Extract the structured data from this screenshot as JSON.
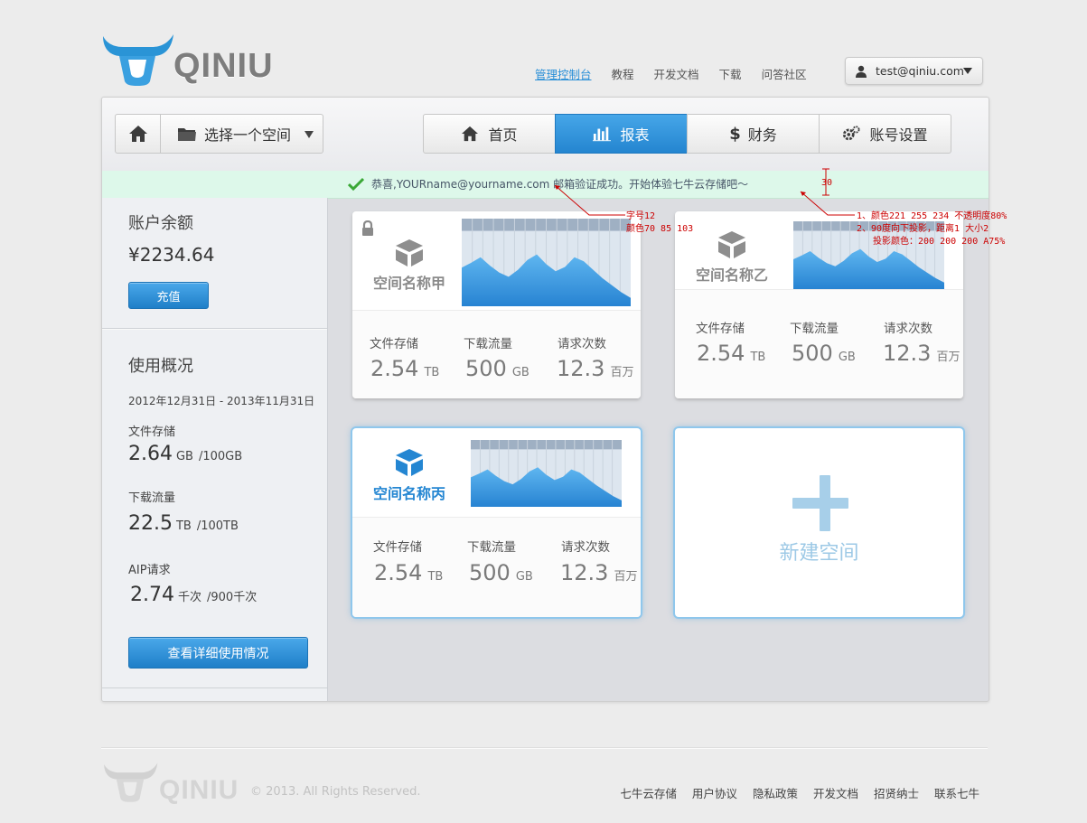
{
  "brand": {
    "logo_text": "QINIU"
  },
  "topnav": {
    "items": [
      "管理控制台",
      "教程",
      "开发文档",
      "下载",
      "问答社区"
    ],
    "user_email": "test@qiniu.com"
  },
  "toolbar": {
    "space_select_label": "选择一个空间",
    "tabs": [
      {
        "label": "首页",
        "icon": "home-icon"
      },
      {
        "label": "报表",
        "icon": "bar-chart-icon"
      },
      {
        "label": "财务",
        "icon": "dollar-icon",
        "glyph": "$"
      },
      {
        "label": "账号设置",
        "icon": "gear-icon"
      }
    ],
    "active_tab": "报表"
  },
  "notice": {
    "message": "恭喜,YOURname@yourname.com 邮箱验证成功。开始体验七牛云存储吧～"
  },
  "sidebar": {
    "balance_title": "账户余额",
    "balance": "¥2234.64",
    "recharge_label": "充值",
    "usage_title": "使用概况",
    "date_range": "2012年12月31日 - 2013年11月31日",
    "storage": {
      "label": "文件存储",
      "value": "2.64",
      "unit": "GB",
      "quota": "/100GB"
    },
    "traffic": {
      "label": "下载流量",
      "value": "22.5",
      "unit": "TB",
      "quota": "/100TB"
    },
    "api": {
      "label": "AIP请求",
      "value": "2.74",
      "unit": "千次",
      "quota": "/900千次"
    },
    "detail_button": "查看详细使用情况"
  },
  "cards": [
    {
      "name": "空间名称甲",
      "locked": true,
      "selected": false,
      "labels": [
        "文件存储",
        "下载流量",
        "请求次数"
      ],
      "storage": {
        "value": "2.54",
        "unit": "TB"
      },
      "traffic": {
        "value": "500",
        "unit": "GB"
      },
      "requests": {
        "value": "12.3",
        "unit": "百万"
      }
    },
    {
      "name": "空间名称乙",
      "locked": false,
      "selected": false,
      "labels": [
        "文件存储",
        "下载流量",
        "请求次数"
      ],
      "storage": {
        "value": "2.54",
        "unit": "TB"
      },
      "traffic": {
        "value": "500",
        "unit": "GB"
      },
      "requests": {
        "value": "12.3",
        "unit": "百万"
      }
    },
    {
      "name": "空间名称丙",
      "locked": false,
      "selected": true,
      "labels": [
        "文件存储",
        "下载流量",
        "请求次数"
      ],
      "storage": {
        "value": "2.54",
        "unit": "TB"
      },
      "traffic": {
        "value": "500",
        "unit": "GB"
      },
      "requests": {
        "value": "12.3",
        "unit": "百万"
      }
    }
  ],
  "new_space": {
    "label": "新建空间"
  },
  "annotations": {
    "font_note": [
      "字号12",
      "颜色70 85 103"
    ],
    "spacing_note": "30",
    "card_note": [
      "1、颜色221 255 234  不透明度80%",
      "2、90度向下投影，距离1 大小2",
      "投影颜色：200 200 200  A75%"
    ]
  },
  "footer": {
    "logo_text": "QINIU",
    "copyright": "© 2013. All Rights Reserved.",
    "links": [
      "七牛云存储",
      "用户协议",
      "隐私政策",
      "开发文档",
      "招贤纳士",
      "联系七牛"
    ]
  },
  "colors": {
    "accent": "#2a8fd7",
    "tab_active": "#2485d0",
    "notice_bg": "#ddf8ea",
    "notice_text": "#465567",
    "annotation": "#cc0000"
  }
}
